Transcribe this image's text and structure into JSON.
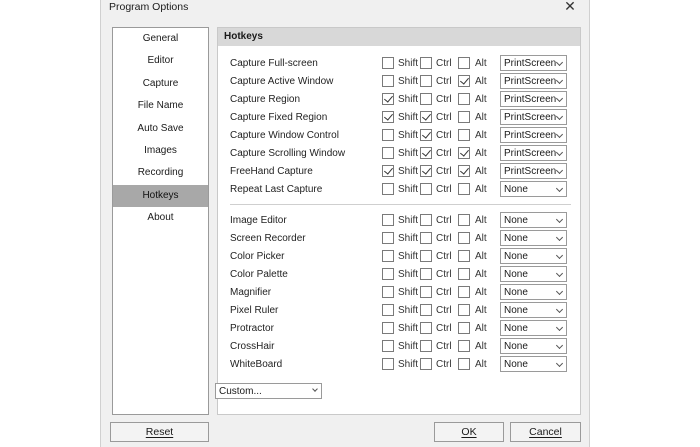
{
  "window": {
    "title": "Program Options"
  },
  "sidebar": {
    "items": [
      {
        "label": "General",
        "active": false
      },
      {
        "label": "Editor",
        "active": false
      },
      {
        "label": "Capture",
        "active": false
      },
      {
        "label": "File Name",
        "active": false
      },
      {
        "label": "Auto Save",
        "active": false
      },
      {
        "label": "Images",
        "active": false
      },
      {
        "label": "Recording",
        "active": false
      },
      {
        "label": "Hotkeys",
        "active": true
      },
      {
        "label": "About",
        "active": false
      }
    ]
  },
  "panel": {
    "title": "Hotkeys",
    "modifiers": {
      "shift": "Shift",
      "ctrl": "Ctrl",
      "alt": "Alt"
    },
    "capture_rows": [
      {
        "label": "Capture Full-screen",
        "shift": false,
        "ctrl": false,
        "alt": false,
        "key": "PrintScreen"
      },
      {
        "label": "Capture Active Window",
        "shift": false,
        "ctrl": false,
        "alt": true,
        "key": "PrintScreen"
      },
      {
        "label": "Capture Region",
        "shift": true,
        "ctrl": false,
        "alt": false,
        "key": "PrintScreen"
      },
      {
        "label": "Capture Fixed Region",
        "shift": true,
        "ctrl": true,
        "alt": false,
        "key": "PrintScreen"
      },
      {
        "label": "Capture Window Control",
        "shift": false,
        "ctrl": true,
        "alt": false,
        "key": "PrintScreen"
      },
      {
        "label": "Capture Scrolling Window",
        "shift": false,
        "ctrl": true,
        "alt": true,
        "key": "PrintScreen"
      },
      {
        "label": "FreeHand Capture",
        "shift": true,
        "ctrl": true,
        "alt": true,
        "key": "PrintScreen"
      },
      {
        "label": "Repeat Last Capture",
        "shift": false,
        "ctrl": false,
        "alt": false,
        "key": "None"
      }
    ],
    "tool_rows": [
      {
        "label": "Image Editor",
        "shift": false,
        "ctrl": false,
        "alt": false,
        "key": "None"
      },
      {
        "label": "Screen Recorder",
        "shift": false,
        "ctrl": false,
        "alt": false,
        "key": "None"
      },
      {
        "label": "Color Picker",
        "shift": false,
        "ctrl": false,
        "alt": false,
        "key": "None"
      },
      {
        "label": "Color Palette",
        "shift": false,
        "ctrl": false,
        "alt": false,
        "key": "None"
      },
      {
        "label": "Magnifier",
        "shift": false,
        "ctrl": false,
        "alt": false,
        "key": "None"
      },
      {
        "label": "Pixel Ruler",
        "shift": false,
        "ctrl": false,
        "alt": false,
        "key": "None"
      },
      {
        "label": "Protractor",
        "shift": false,
        "ctrl": false,
        "alt": false,
        "key": "None"
      },
      {
        "label": "CrossHair",
        "shift": false,
        "ctrl": false,
        "alt": false,
        "key": "None"
      },
      {
        "label": "WhiteBoard",
        "shift": false,
        "ctrl": false,
        "alt": false,
        "key": "None"
      }
    ]
  },
  "custom_dropdown": {
    "value": "Custom..."
  },
  "buttons": {
    "reset": "Reset",
    "ok": "OK",
    "cancel": "Cancel"
  }
}
